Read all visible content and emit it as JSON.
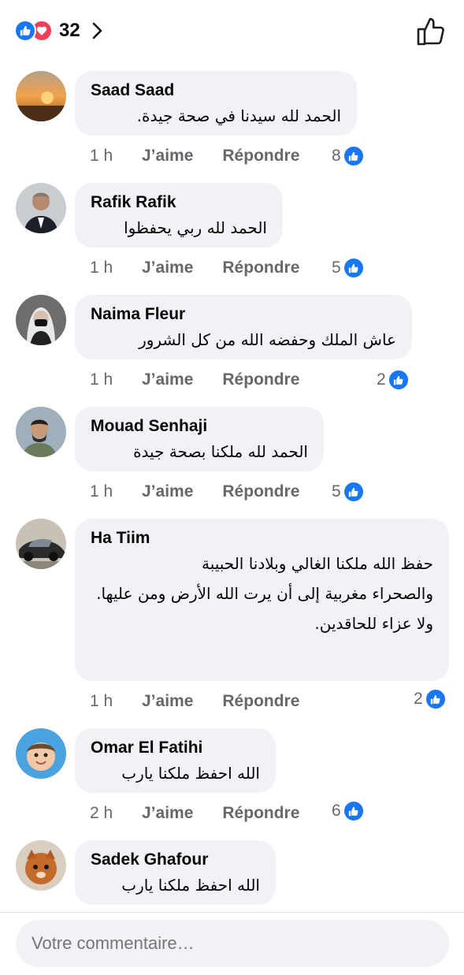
{
  "header": {
    "reaction_count": "32"
  },
  "comments": [
    {
      "author": "Saad Saad",
      "text": "الحمد لله سيدنا في صحة جيدة.",
      "time": "1 h",
      "like_label": "J’aime",
      "reply_label": "Répondre",
      "reactions": "8"
    },
    {
      "author": "Rafik Rafik",
      "text": "الحمد لله ربي يحفظوا",
      "time": "1 h",
      "like_label": "J’aime",
      "reply_label": "Répondre",
      "reactions": "5"
    },
    {
      "author": "Naima Fleur",
      "text": "عاش الملك وحفضه الله من كل الشرور",
      "time": "1 h",
      "like_label": "J’aime",
      "reply_label": "Répondre",
      "reactions": "2"
    },
    {
      "author": "Mouad Senhaji",
      "text": "الحمد لله ملكنا بصحة جيدة",
      "time": "1 h",
      "like_label": "J’aime",
      "reply_label": "Répondre",
      "reactions": "5"
    },
    {
      "author": "Ha Tiim",
      "text": "حفظ الله ملكنا الغالي وبلادنا الحبيبة\nوالصحراء مغربية إلى أن يرت الله الأرض ومن عليها.\nولا عزاء للحاقدين.",
      "time": "1 h",
      "like_label": "J’aime",
      "reply_label": "Répondre",
      "reactions": "2"
    },
    {
      "author": "Omar El Fatihi",
      "text": "الله احفظ ملكنا يارب",
      "time": "2 h",
      "like_label": "J’aime",
      "reply_label": "Répondre",
      "reactions": "6"
    },
    {
      "author": "Sadek Ghafour",
      "text": "الله احفظ ملكنا يارب"
    }
  ],
  "composer": {
    "placeholder": "Votre commentaire…"
  },
  "colors": {
    "like_blue": "#1877f2",
    "love_red": "#f33e58",
    "bubble_bg": "#f0f2f5",
    "meta_gray": "#65676b"
  }
}
